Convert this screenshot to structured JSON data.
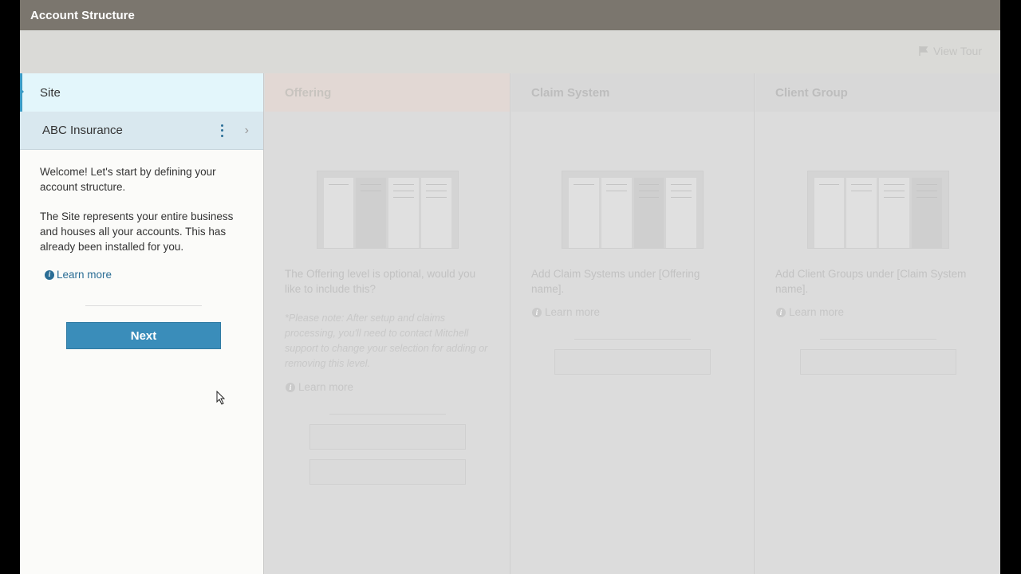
{
  "app": {
    "title": "Account Structure"
  },
  "toolbar": {
    "tour_label": "View Tour"
  },
  "columns": {
    "site": {
      "header": "Site",
      "item_name": "ABC Insurance",
      "welcome": "Welcome! Let's start by defining your account structure.",
      "description": "The Site represents your entire business and houses all your accounts. This has already been installed for you.",
      "learn_more": "Learn more",
      "next_label": "Next"
    },
    "offering": {
      "header": "Offering",
      "prompt": "The Offering level is optional, would you like to include this?",
      "note": "*Please note: After setup and claims processing, you'll need to contact Mitchell support to change your selection for adding or removing this level.",
      "learn_more": "Learn more"
    },
    "claim_system": {
      "header": "Claim System",
      "prompt": "Add Claim Systems under [Offering name].",
      "learn_more": "Learn more"
    },
    "client_group": {
      "header": "Client Group",
      "prompt": "Add Client Groups under [Claim System name].",
      "learn_more": "Learn more"
    }
  }
}
